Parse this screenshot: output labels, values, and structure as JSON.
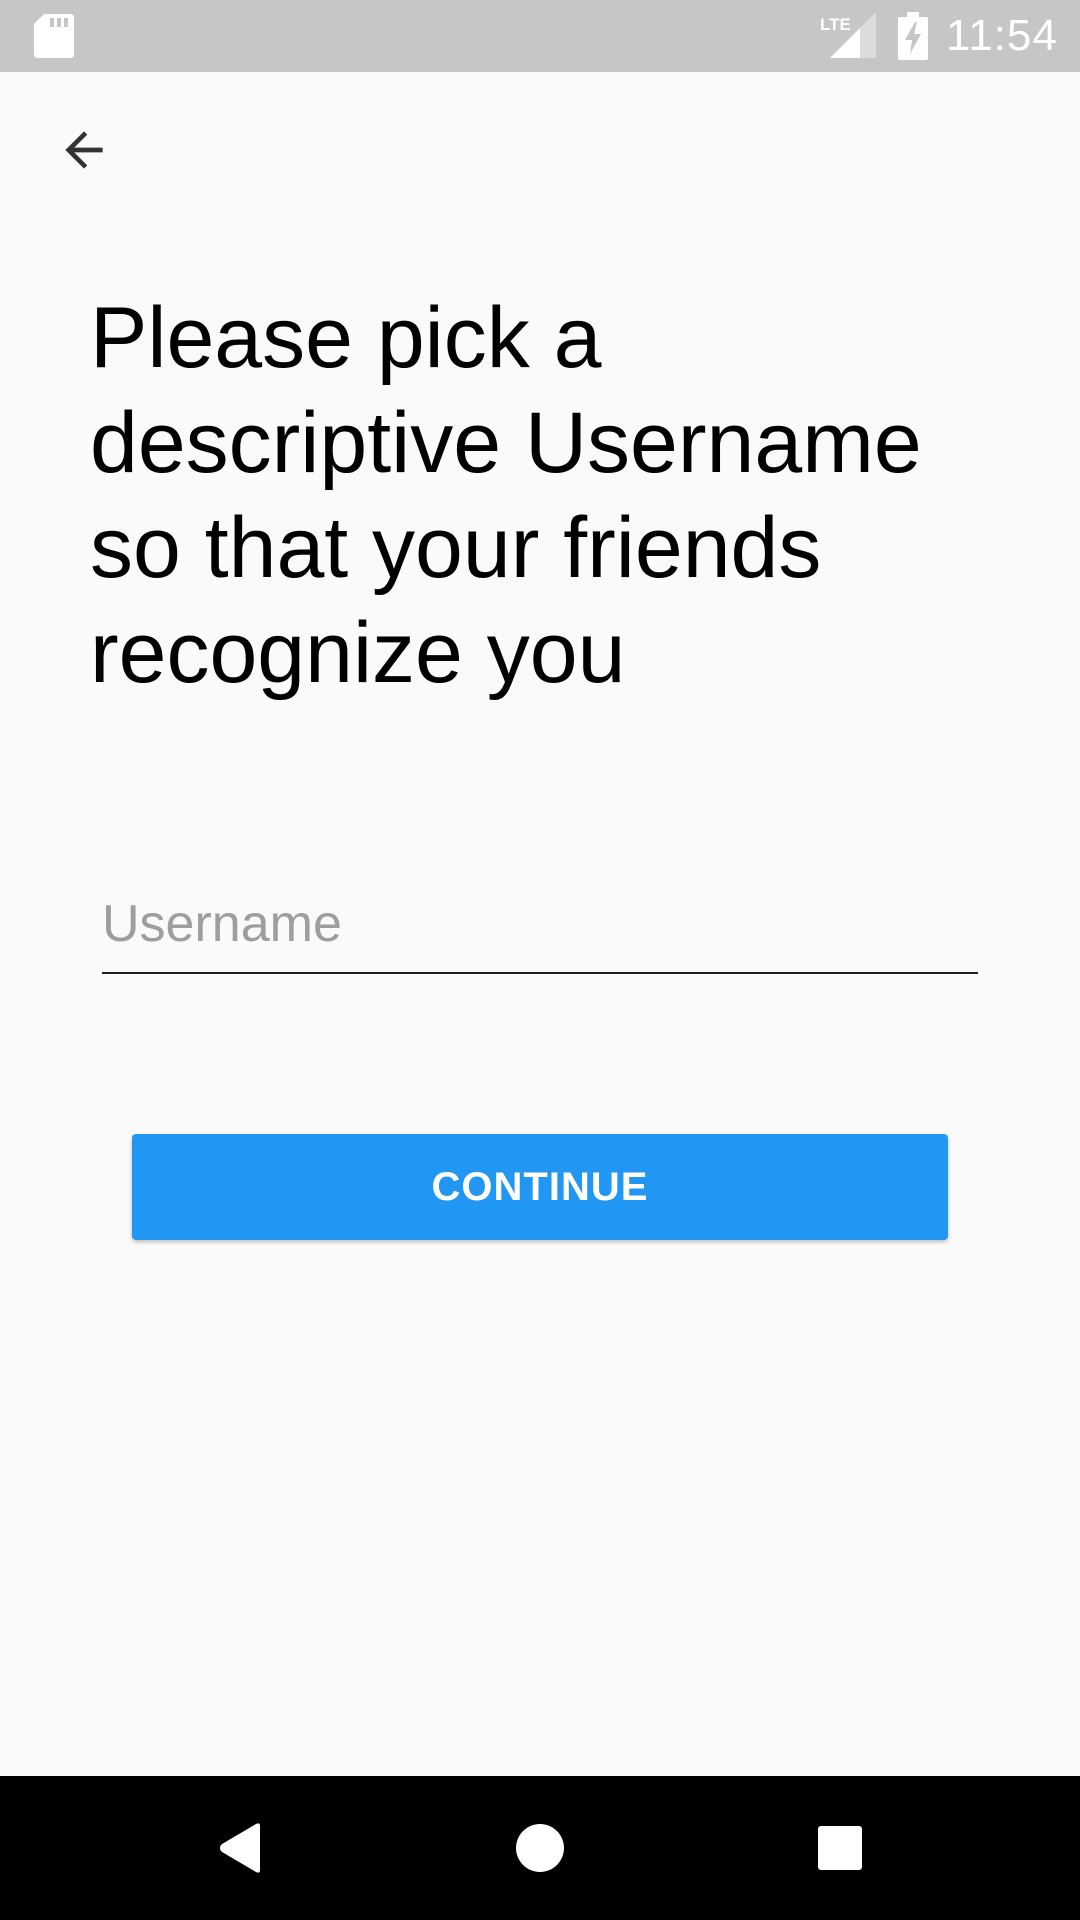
{
  "status_bar": {
    "time": "11:54",
    "network_label": "LTE",
    "icons": [
      "sd-card-icon",
      "lte-signal-icon",
      "battery-charging-icon"
    ],
    "background_color": "#c6c6c6"
  },
  "toolbar": {
    "back_icon": "arrow-back-icon"
  },
  "main": {
    "headline": "Please pick a descriptive Username so that your friends recognize you",
    "username_input": {
      "placeholder": "Username",
      "value": ""
    },
    "continue_label": "CONTINUE"
  },
  "navigation_bar": {
    "icons": [
      "nav-back-icon",
      "nav-home-icon",
      "nav-recents-icon"
    ]
  },
  "colors": {
    "accent": "#2196f3",
    "background": "#fafafa",
    "nav_bar": "#000000"
  }
}
